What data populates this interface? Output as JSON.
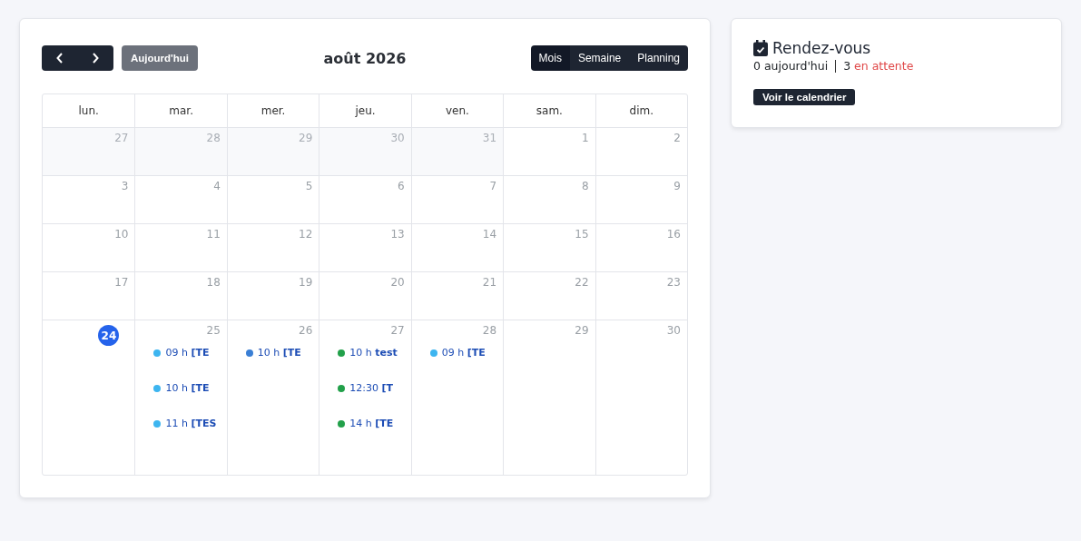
{
  "calendar": {
    "nav": {
      "today_button": "Aujourd'hui"
    },
    "title": "août 2026",
    "views": [
      {
        "label": "Mois",
        "selected": true
      },
      {
        "label": "Semaine",
        "selected": false
      },
      {
        "label": "Planning",
        "selected": false
      }
    ],
    "weekdays": [
      "lun.",
      "mar.",
      "mer.",
      "jeu.",
      "ven.",
      "sam.",
      "dim."
    ],
    "weeks": [
      [
        {
          "day": "27",
          "outside": true,
          "today": false
        },
        {
          "day": "28",
          "outside": true,
          "today": false
        },
        {
          "day": "29",
          "outside": true,
          "today": false
        },
        {
          "day": "30",
          "outside": true,
          "today": false
        },
        {
          "day": "31",
          "outside": true,
          "today": false
        },
        {
          "day": "1",
          "outside": false,
          "today": false
        },
        {
          "day": "2",
          "outside": false,
          "today": false
        }
      ],
      [
        {
          "day": "3",
          "outside": false,
          "today": false
        },
        {
          "day": "4",
          "outside": false,
          "today": false
        },
        {
          "day": "5",
          "outside": false,
          "today": false
        },
        {
          "day": "6",
          "outside": false,
          "today": false
        },
        {
          "day": "7",
          "outside": false,
          "today": false
        },
        {
          "day": "8",
          "outside": false,
          "today": false
        },
        {
          "day": "9",
          "outside": false,
          "today": false
        }
      ],
      [
        {
          "day": "10",
          "outside": false,
          "today": false
        },
        {
          "day": "11",
          "outside": false,
          "today": false
        },
        {
          "day": "12",
          "outside": false,
          "today": false
        },
        {
          "day": "13",
          "outside": false,
          "today": false
        },
        {
          "day": "14",
          "outside": false,
          "today": false
        },
        {
          "day": "15",
          "outside": false,
          "today": false
        },
        {
          "day": "16",
          "outside": false,
          "today": false
        }
      ],
      [
        {
          "day": "17",
          "outside": false,
          "today": false
        },
        {
          "day": "18",
          "outside": false,
          "today": false
        },
        {
          "day": "19",
          "outside": false,
          "today": false
        },
        {
          "day": "20",
          "outside": false,
          "today": false
        },
        {
          "day": "21",
          "outside": false,
          "today": false
        },
        {
          "day": "22",
          "outside": false,
          "today": false
        },
        {
          "day": "23",
          "outside": false,
          "today": false
        }
      ],
      [
        {
          "day": "24",
          "outside": false,
          "today": true
        },
        {
          "day": "25",
          "outside": false,
          "today": false,
          "events": [
            {
              "time": "09 h",
              "title": "[TE",
              "color": "#3db5f0"
            },
            {
              "time": "10 h",
              "title": "[TE",
              "color": "#3db5f0"
            },
            {
              "time": "11 h",
              "title": "[TES",
              "color": "#3db5f0"
            }
          ]
        },
        {
          "day": "26",
          "outside": false,
          "today": false,
          "events": [
            {
              "time": "10 h",
              "title": "[TE",
              "color": "#3a7fd5"
            }
          ]
        },
        {
          "day": "27",
          "outside": false,
          "today": false,
          "events": [
            {
              "time": "10 h",
              "title": "test",
              "color": "#22a04a"
            },
            {
              "time": "12:30",
              "title": "[T",
              "color": "#22a04a"
            },
            {
              "time": "14 h",
              "title": "[TE",
              "color": "#22a04a"
            }
          ]
        },
        {
          "day": "28",
          "outside": false,
          "today": false,
          "events": [
            {
              "time": "09 h",
              "title": "[TE",
              "color": "#3db5f0"
            }
          ]
        },
        {
          "day": "29",
          "outside": false,
          "today": false
        },
        {
          "day": "30",
          "outside": false,
          "today": false
        }
      ]
    ]
  },
  "appointments": {
    "title": "Rendez-vous",
    "today_count": "0",
    "today_label": "aujourd'hui",
    "pending_count": "3",
    "pending_label": "en attente",
    "button": "Voir le calendrier"
  }
}
